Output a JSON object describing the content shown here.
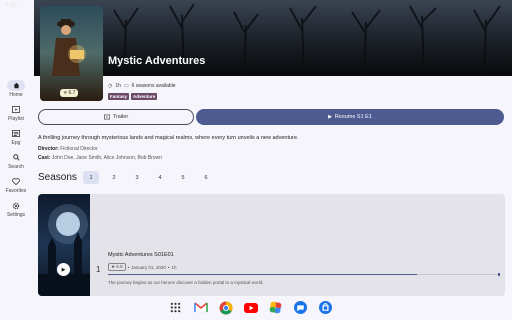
{
  "status": {
    "time": "4:30"
  },
  "show": {
    "title": "Mystic Adventures",
    "rating": "6.7",
    "year": "1h",
    "seasons_available": "6 seasons available",
    "tags": [
      "Fantasy",
      "Adventure"
    ],
    "description": "A thrilling journey through mysterious lands and magical realms, where every turn unveils a new adventure.",
    "director_label": "Director:",
    "director": "Fictional Director",
    "cast_label": "Cast:",
    "cast": "John Doe, Jane Smith, Alice Johnson, Bob Brown"
  },
  "buttons": {
    "trailer": "Trailer",
    "resume": "Resume S1 E1"
  },
  "nav": {
    "items": [
      {
        "label": "Home",
        "icon": "home-icon"
      },
      {
        "label": "Playlist",
        "icon": "playlist-icon"
      },
      {
        "label": "Epg",
        "icon": "epg-icon"
      },
      {
        "label": "Search",
        "icon": "search-icon"
      },
      {
        "label": "Favorites",
        "icon": "heart-icon"
      },
      {
        "label": "Settings",
        "icon": "gear-icon"
      }
    ]
  },
  "seasons": {
    "label": "Seasons",
    "tabs": [
      "1",
      "2",
      "3",
      "4",
      "5",
      "6"
    ],
    "selected": "1"
  },
  "episode": {
    "number": "1",
    "title": "Mystic Adventures S01E01",
    "rating": "6.9",
    "date": "January 01, 2020",
    "duration": "1h",
    "progress": 0.79,
    "description": "The journey begins as our heroes discover a hidden portal to a mystical world."
  },
  "colors": {
    "accent": "#4d5b91",
    "tag": "#6a4a66",
    "selected_tab": "#dde0f3"
  },
  "taskbar": {
    "apps": [
      "apps-grid-icon",
      "gmail-icon",
      "chrome-icon",
      "youtube-icon",
      "photos-icon",
      "messages-icon",
      "app-store-icon"
    ]
  }
}
